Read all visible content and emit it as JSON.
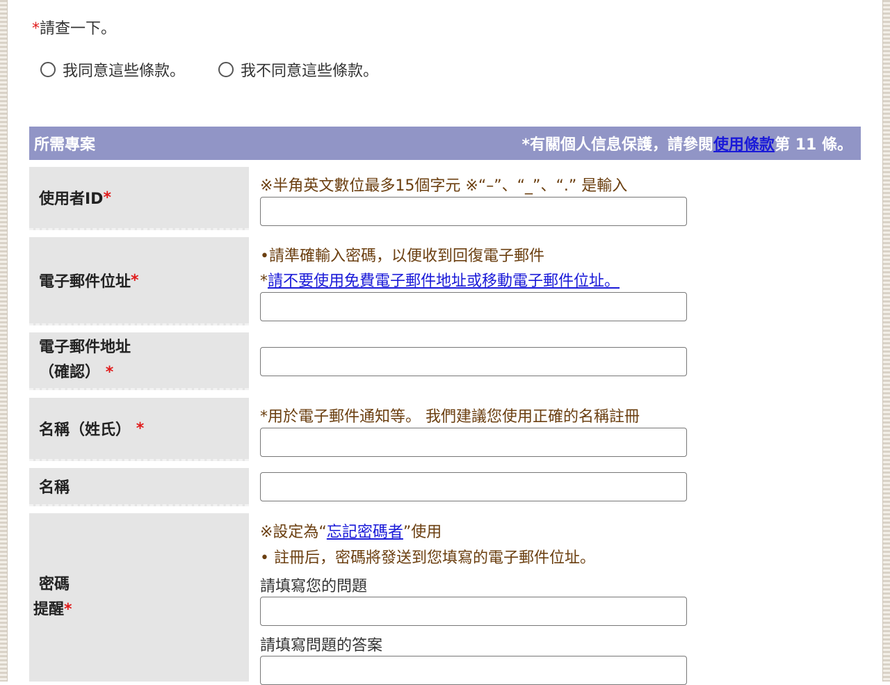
{
  "consent": {
    "required_mark": "*",
    "title": "請查一下。",
    "agree_label": "我同意這些條款。",
    "disagree_label": "我不同意這些條款。"
  },
  "section": {
    "title": "所需專案",
    "privacy_prefix": "*有關個人信息保護，請參閱",
    "privacy_link": "使用條款",
    "privacy_suffix": "第 11 條。"
  },
  "fields": {
    "user_id": {
      "label": "使用者ID",
      "required": "*",
      "note": "※半角英文數位最多15個字元 ※“–”、“_”、“.” 是輸入",
      "value": ""
    },
    "email": {
      "label": "電子郵件位址",
      "required": "*",
      "note1": "•請準確輸入密碼，以便收到回復電子郵件",
      "note2_prefix": "*",
      "note2_link": "請不要使用免費電子郵件地址或移動電子郵件位址。",
      "value": ""
    },
    "email_confirm": {
      "label_line1": "電子郵件地址",
      "label_line2": "（確認）",
      "required": "*",
      "value": ""
    },
    "name_family": {
      "label": "名稱（姓氏）",
      "required": "*",
      "note": "*用於電子郵件通知等。 我們建議您使用正確的名稱註冊",
      "value": ""
    },
    "name_given": {
      "label": "名稱",
      "value": ""
    },
    "password_hint": {
      "label_line1": "密碼",
      "label_line2": "提醒",
      "required": "*",
      "note1_prefix": "※設定為“",
      "note1_link": "忘記密碼者",
      "note1_suffix": "”使用",
      "note2": "• 註冊后，密碼將發送到您填寫的電子郵件位址。",
      "question_label": "請填寫您的問題",
      "question_value": "",
      "answer_label": "請填寫問題的答案",
      "answer_value": ""
    }
  },
  "colors": {
    "section_bar": "#9195c6",
    "label_bg": "#e5e5e5",
    "note_text": "#6b3f10",
    "required": "#e01b1b",
    "link": "#1a1ad8"
  }
}
